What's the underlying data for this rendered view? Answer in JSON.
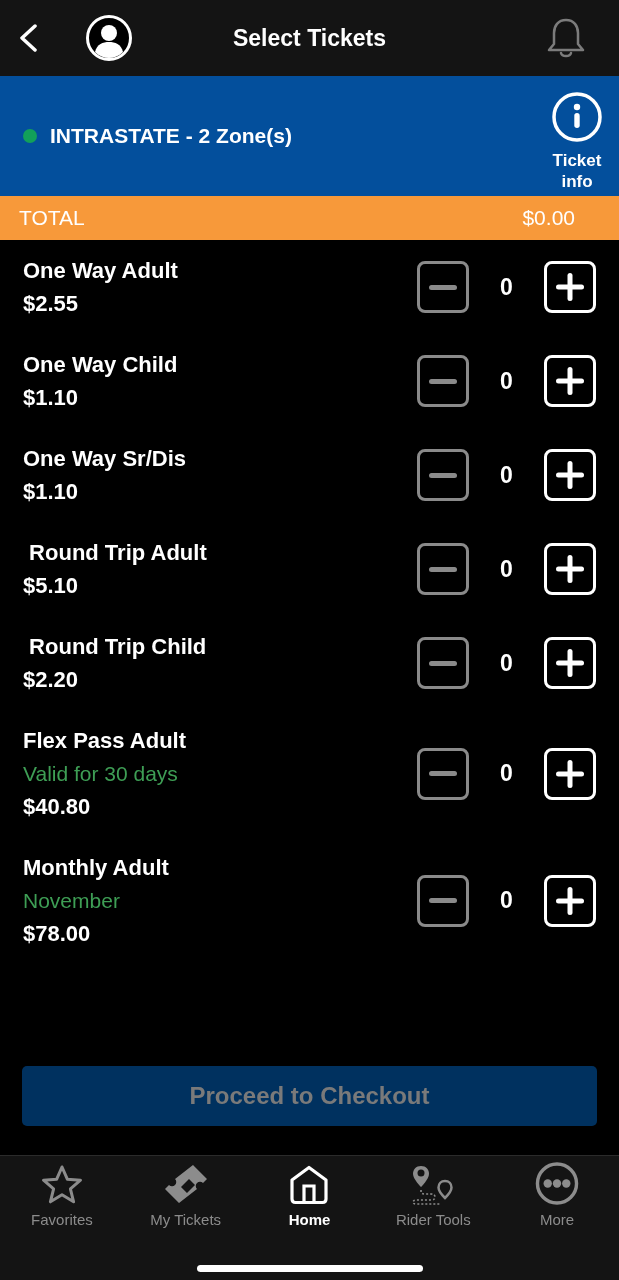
{
  "header": {
    "title": "Select Tickets"
  },
  "zone": {
    "label": "INTRASTATE - 2 Zone(s)",
    "info_label": "Ticket info"
  },
  "total": {
    "label": "TOTAL",
    "amount": "$0.00"
  },
  "tickets": [
    {
      "name": "One Way Adult",
      "price": "$2.55",
      "count": "0",
      "minus_disabled": true
    },
    {
      "name": "One Way Child",
      "price": "$1.10",
      "count": "0",
      "minus_disabled": true
    },
    {
      "name": "One Way Sr/Dis",
      "price": "$1.10",
      "count": "0",
      "minus_disabled": true
    },
    {
      "name": " Round Trip Adult",
      "price": "$5.10",
      "count": "0",
      "minus_disabled": true
    },
    {
      "name": " Round Trip Child",
      "price": "$2.20",
      "count": "0",
      "minus_disabled": true
    },
    {
      "name": "Flex Pass Adult",
      "note": "Valid for 30 days",
      "price": "$40.80",
      "count": "0",
      "minus_disabled": true
    },
    {
      "name": "Monthly Adult",
      "note": "November",
      "price": "$78.00",
      "count": "0",
      "minus_disabled": true
    }
  ],
  "checkout": {
    "label": "Proceed to Checkout",
    "disabled": true
  },
  "tab_bar": [
    {
      "label": "Favorites",
      "selected": false
    },
    {
      "label": "My Tickets",
      "selected": false
    },
    {
      "label": "Home",
      "selected": true
    },
    {
      "label": "Rider Tools",
      "selected": false
    },
    {
      "label": "More",
      "selected": false
    }
  ]
}
